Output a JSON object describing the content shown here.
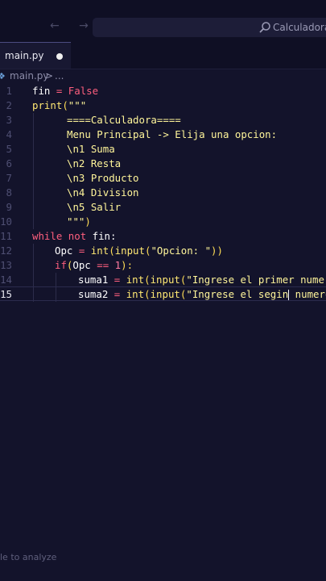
{
  "header": {
    "search_label": "Calculadora",
    "nav_arrows": "← →"
  },
  "tab": {
    "label": "main.py"
  },
  "breadcrumb": {
    "file": "main.py",
    "separator": ">",
    "more": "..."
  },
  "editor": {
    "line_numbers": [
      "1",
      "2",
      "3",
      "4",
      "5",
      "6",
      "7",
      "8",
      "9",
      "10",
      "11",
      "12",
      "13",
      "14",
      "15"
    ],
    "current_line": 15,
    "code_text": {
      "l1": {
        "a": "fin",
        "b": "=",
        "c": "False"
      },
      "l2": {
        "a": "print",
        "b": "(",
        "c": "\"\"\""
      },
      "l3": "====Calculadora====",
      "l4": "Menu Principal -> Elija una opcion:",
      "l5": "\\n1 Suma",
      "l6": "\\n2 Resta",
      "l7": "\\n3 Producto",
      "l8": "\\n4 Division",
      "l9": "\\n5 Salir",
      "l10": {
        "a": "\"\"\"",
        "b": ")"
      },
      "l11": {
        "a": "while",
        "b": "not",
        "c": "fin:"
      },
      "l12": {
        "a": "Opc",
        "b": "=",
        "c": "int",
        "d": "(",
        "e": "input",
        "f": "(",
        "g": "\"Opcion: \"",
        "h": "))"
      },
      "l13": {
        "a": "if",
        "b": "(",
        "c": "Opc",
        "d": "==",
        "e": "1",
        "f": "):"
      },
      "l14": {
        "a": "suma1",
        "b": "=",
        "c": "int",
        "d": "(",
        "e": "input",
        "f": "(",
        "g": "\"Ingrese el primer numero"
      },
      "l15": {
        "a": "suma2",
        "b": "=",
        "c": "int",
        "d": "(",
        "e": "input",
        "f": "(",
        "g": "\"Ingrese el segin",
        "h": " numero:"
      }
    }
  },
  "status": {
    "text": "le to analyze"
  },
  "colors": {
    "background": "#13132b",
    "keyword": "#ff5f7e",
    "function": "#ffe873",
    "string": "#fff59a"
  }
}
